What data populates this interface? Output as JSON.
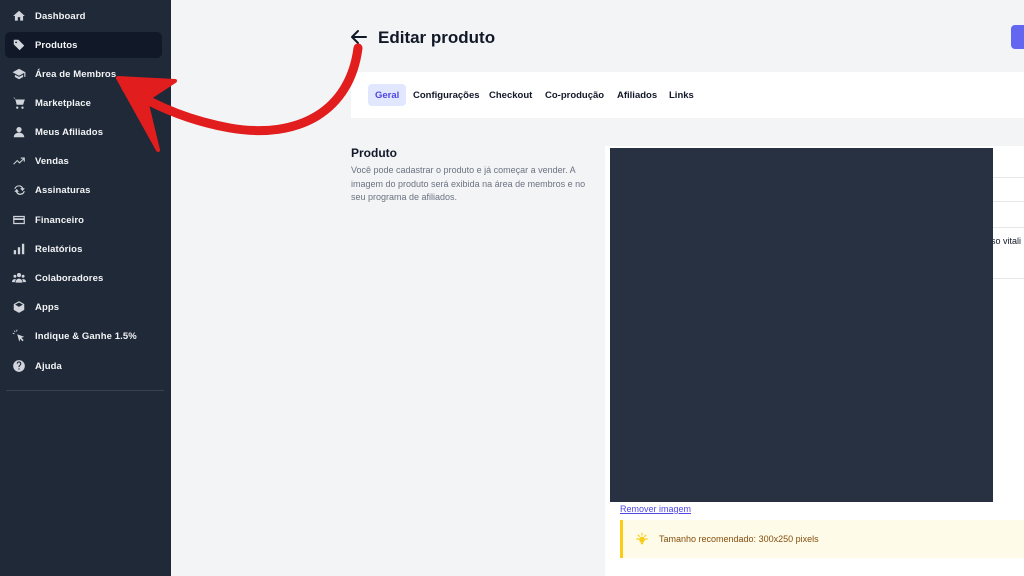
{
  "sidebar": {
    "items": [
      {
        "label": "Dashboard",
        "icon": "home-icon"
      },
      {
        "label": "Produtos",
        "icon": "tag-icon",
        "active": true
      },
      {
        "label": "Área de Membros",
        "icon": "graduation-cap-icon"
      },
      {
        "label": "Marketplace",
        "icon": "cart-icon"
      },
      {
        "label": "Meus Afiliados",
        "icon": "user-icon"
      },
      {
        "label": "Vendas",
        "icon": "trending-up-icon"
      },
      {
        "label": "Assinaturas",
        "icon": "refresh-icon"
      },
      {
        "label": "Financeiro",
        "icon": "credit-card-icon"
      },
      {
        "label": "Relatórios",
        "icon": "bar-chart-icon"
      },
      {
        "label": "Colaboradores",
        "icon": "users-icon"
      },
      {
        "label": "Apps",
        "icon": "cube-icon"
      },
      {
        "label": "Indique & Ganhe 1.5%",
        "icon": "cursor-click-icon"
      },
      {
        "label": "Ajuda",
        "icon": "question-icon"
      }
    ]
  },
  "header": {
    "title": "Editar produto"
  },
  "tabs": [
    {
      "label": "Geral",
      "active": true
    },
    {
      "label": "Configurações"
    },
    {
      "label": "Checkout"
    },
    {
      "label": "Co-produção"
    },
    {
      "label": "Afiliados"
    },
    {
      "label": "Links"
    }
  ],
  "product_section": {
    "title": "Produto",
    "description": "Você pode cadastrar o produto e já começar a vender. A imagem do produto será exibida na área de membros e no seu programa de afiliados.",
    "truncated_field_text": "so vitali",
    "remove_image_label": "Remover imagem",
    "notice_text": "Tamanho recomendado: 300x250 pixels"
  },
  "colors": {
    "sidebar_bg": "#1f2937",
    "accent": "#4f46e5",
    "annotation_arrow": "#e11d1d",
    "image_placeholder": "#273142"
  }
}
